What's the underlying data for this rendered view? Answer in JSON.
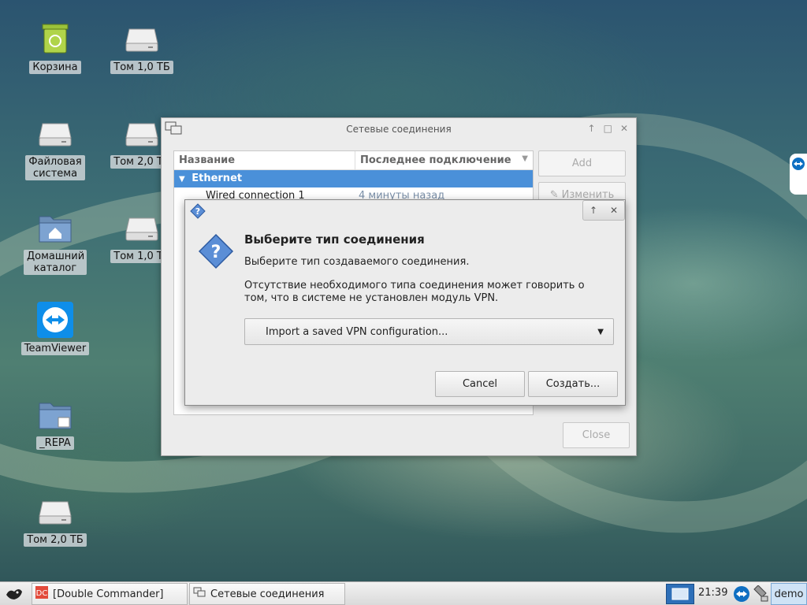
{
  "desktop": {
    "icons": [
      {
        "label": "Корзина",
        "icon": "trash-icon"
      },
      {
        "label": "Том 1,0 ТБ",
        "icon": "drive-icon"
      },
      {
        "label": "Файловая система",
        "icon": "drive-icon"
      },
      {
        "label": "Том 2,0 ТБ",
        "icon": "drive-icon"
      },
      {
        "label": "Домашний каталог",
        "icon": "home-folder-icon"
      },
      {
        "label": "Том 1,0 ТБ",
        "icon": "drive-icon"
      },
      {
        "label": "TeamViewer",
        "icon": "teamviewer-icon"
      },
      {
        "label": "_REPA",
        "icon": "folder-link-icon"
      },
      {
        "label": "Том 2,0 ТБ",
        "icon": "drive-icon"
      }
    ]
  },
  "network_window": {
    "title": "Сетевые соединения",
    "columns": [
      "Название",
      "Последнее подключение"
    ],
    "group": "Ethernet",
    "rows": [
      {
        "name": "Wired connection 1",
        "last": "4 минуты назад"
      }
    ],
    "buttons": {
      "add": "Add",
      "edit": "Изменить",
      "close": "Close"
    }
  },
  "choose_dialog": {
    "heading": "Выберите тип соединения",
    "subheading": "Выберите тип создаваемого соединения.",
    "note": "Отсутствие необходимого типа соединения может говорить о том, что в системе не установлен модуль VPN.",
    "selected_type": "Import a saved VPN configuration...",
    "buttons": {
      "cancel": "Cancel",
      "create": "Создать..."
    }
  },
  "taskbar": {
    "tasks": [
      "[Double Commander]",
      "Сетевые соединения"
    ],
    "clock": "21:39",
    "user": "demo"
  },
  "colors": {
    "selection": "#4a90d9",
    "desktop_base": "#3e6f74"
  }
}
